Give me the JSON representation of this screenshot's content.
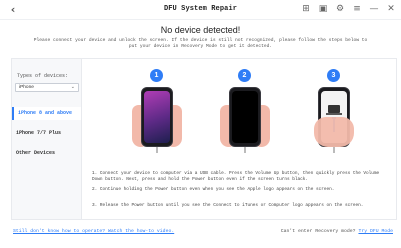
{
  "titlebar": {
    "title": "DFU System Repair",
    "back_icon": "chevron-left-icon",
    "icons": [
      "cart-icon",
      "calendar-icon",
      "settings-icon",
      "menu-icon",
      "minimize-icon",
      "close-icon"
    ]
  },
  "heading": "No device detected!",
  "subheading": "Please connect your device and unlock the screen. If the device is still not recognized, please follow the steps below to put your device in Recovery Mode to get it detected.",
  "sidebar": {
    "types_label": "Types of devices:",
    "dropdown_value": "iPhone",
    "items": [
      {
        "label": "iPhone 8 and above",
        "active": true
      },
      {
        "label": "iPhone 7/7 Plus",
        "active": false
      },
      {
        "label": "Other Devices",
        "active": false
      }
    ]
  },
  "steps": [
    "1",
    "2",
    "3"
  ],
  "instructions": [
    "1. Connect your device to computer via a USB cable. Press the Volume Up button, then quickly press the Volume Down button. Next, press and hold the Power button even if the screen turns black.",
    "2. Continue holding the Power button even when you see the Apple logo appears on the screen.",
    "3. Release the Power button until you see the Connect to iTunes or Computer logo appears on the screen."
  ],
  "footer": {
    "left_link": "Still don't know how to operate? Watch the how-to video.",
    "right_text": "Can't enter Recovery mode?",
    "right_link": "Try DFU Mode"
  },
  "colors": {
    "accent": "#2f7df6",
    "skin": "#f2b9aa",
    "phone": "#1b1b1f"
  }
}
